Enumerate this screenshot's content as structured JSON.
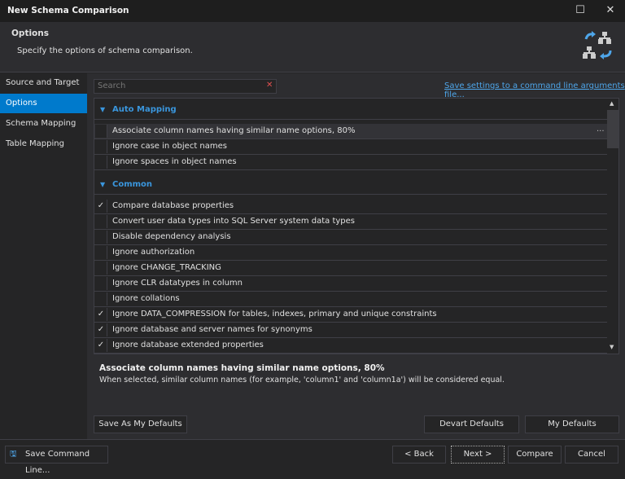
{
  "window": {
    "title": "New Schema Comparison",
    "maximize_icon": "maximize-icon",
    "close_icon": "close-icon"
  },
  "header": {
    "title": "Options",
    "subtitle": "Specify the options of schema comparison."
  },
  "sidebar": {
    "items": [
      {
        "label": "Source and Target"
      },
      {
        "label": "Options",
        "selected": true
      },
      {
        "label": "Schema Mapping"
      },
      {
        "label": "Table Mapping"
      }
    ]
  },
  "search": {
    "placeholder": "Search",
    "value": ""
  },
  "save_link": "Save settings to a command line arguments file...",
  "groups": [
    {
      "name": "Auto Mapping",
      "items": [
        {
          "label": "Associate column names having similar name options, 80%",
          "checked": false,
          "more": "..."
        },
        {
          "label": "Ignore case in object names",
          "checked": false
        },
        {
          "label": "Ignore spaces in object names",
          "checked": false
        }
      ]
    },
    {
      "name": "Common",
      "items": [
        {
          "label": "Compare database properties",
          "checked": true
        },
        {
          "label": "Convert user data types into SQL Server system data types",
          "checked": false
        },
        {
          "label": "Disable dependency analysis",
          "checked": false
        },
        {
          "label": "Ignore authorization",
          "checked": false
        },
        {
          "label": "Ignore CHANGE_TRACKING",
          "checked": false
        },
        {
          "label": "Ignore CLR datatypes in column",
          "checked": false
        },
        {
          "label": "Ignore collations",
          "checked": false
        },
        {
          "label": "Ignore DATA_COMPRESSION for tables, indexes, primary and unique constraints",
          "checked": true
        },
        {
          "label": "Ignore database and server names for synonyms",
          "checked": true
        },
        {
          "label": "Ignore database extended properties",
          "checked": true
        }
      ]
    }
  ],
  "description": {
    "title": "Associate column names having similar name options, 80%",
    "text": "When selected, similar column names (for example, 'column1' and 'column1a') will be considered equal."
  },
  "buttons": {
    "save_as_defaults": "Save As My Defaults",
    "devart_defaults": "Devart Defaults",
    "my_defaults": "My Defaults",
    "save_command_line": "Save Command Line...",
    "back": "< Back",
    "next": "Next >",
    "compare": "Compare",
    "cancel": "Cancel"
  },
  "colors": {
    "accent": "#007acc",
    "link": "#4ea6ea"
  }
}
